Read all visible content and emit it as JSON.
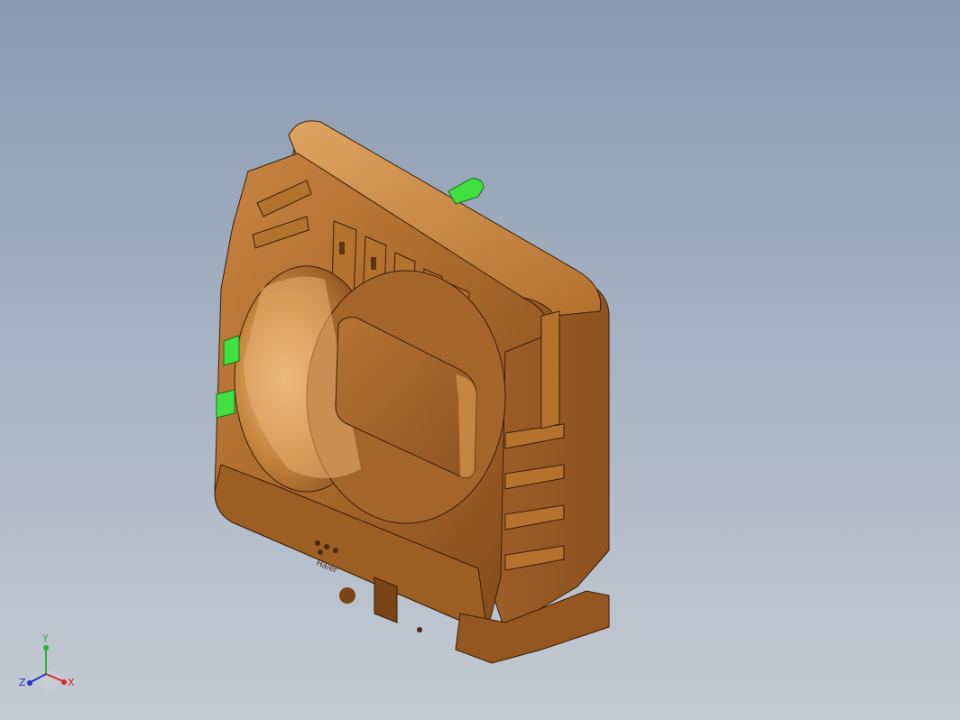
{
  "viewport": {
    "background_top": "#8a9bb0",
    "background_bottom": "#c4cad3"
  },
  "model": {
    "part_color": "#a8672a",
    "part_highlight": "#d99a57",
    "part_shadow": "#6e3f14",
    "selected_faces_color": "#3fe03f",
    "engraved_text": "Haier"
  },
  "triad": {
    "x_label": "X",
    "y_label": "Y",
    "z_label": "Z",
    "x_color": "#d62828",
    "y_color": "#2bb52b",
    "z_color": "#2233cc"
  }
}
